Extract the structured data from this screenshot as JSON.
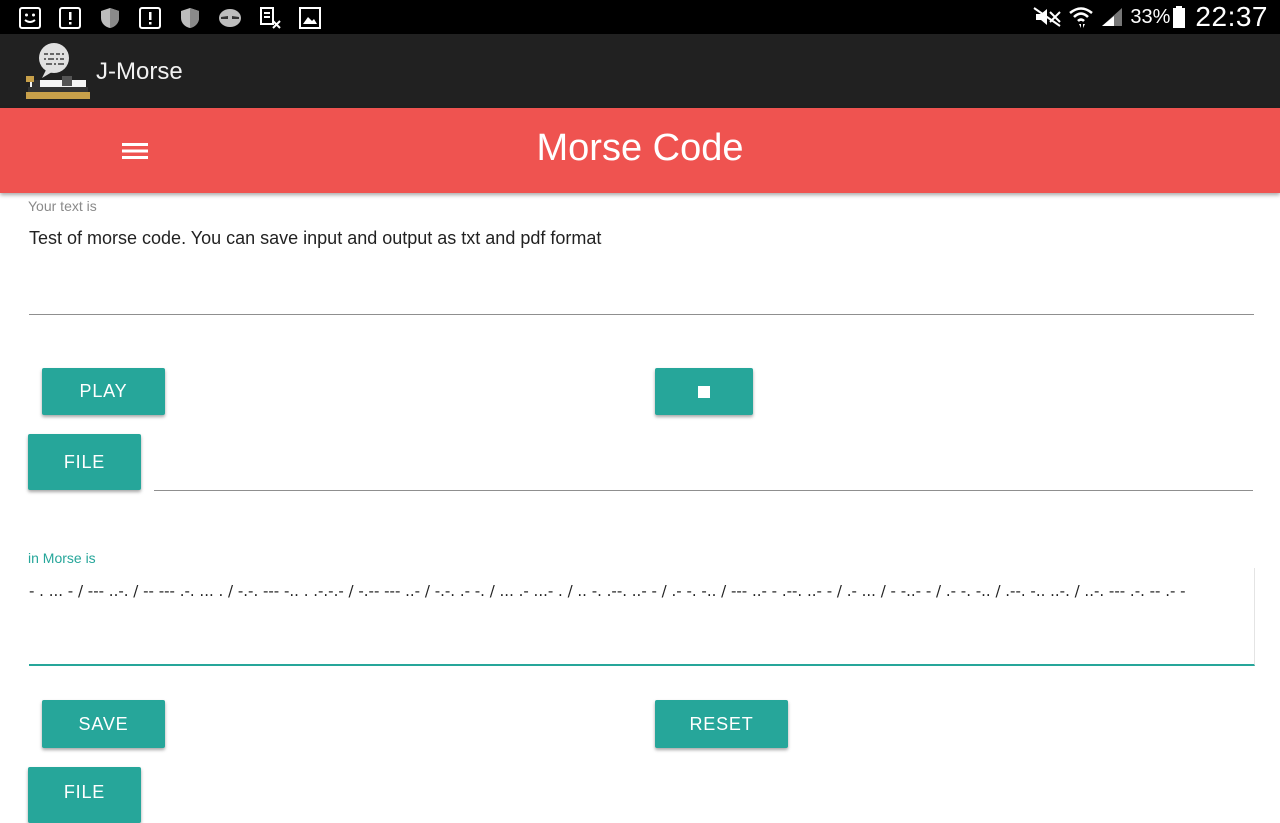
{
  "status_bar": {
    "icons_left": [
      "notification-icon",
      "alert-icon",
      "shield-icon",
      "alert-icon",
      "shield-icon",
      "incognito-icon",
      "document-x-icon",
      "image-icon"
    ],
    "icons_right": [
      "mute-icon",
      "wifi-icon",
      "signal-icon"
    ],
    "battery": "33%",
    "time": "22:37"
  },
  "app_bar": {
    "title": "J-Morse",
    "logo_icon": "telegraph-key-icon"
  },
  "toolbar": {
    "menu_icon": "hamburger-menu-icon",
    "title": "Morse Code",
    "color": "#ef5350"
  },
  "text_input": {
    "label": "Your text is",
    "value": "Test of morse code. You can save input and output as txt and pdf format"
  },
  "buttons": {
    "play": "PLAY",
    "stop_icon": "stop-icon",
    "file_top": "FILE",
    "save": "SAVE",
    "reset": "RESET",
    "file_bottom": "FILE"
  },
  "morse_output": {
    "label": "in Morse is",
    "value": "- . ... - / --- ..-. / -- --- .-. ... . / -.-. --- -.. . .-.-.- / -.-- --- ..- / -.-. .- -. / ... .- ...- . / .. -. .--. ..- - / .- -. -.. / --- ..- - .--. ..- - / .- ... / - -..- - / .- -. -.. / .--. -.. ..-. / ..-. --- .-. -- .- -"
  },
  "colors": {
    "accent": "#26a69a",
    "toolbar": "#ef5350",
    "appbar": "#212121",
    "statusbar": "#000000"
  }
}
